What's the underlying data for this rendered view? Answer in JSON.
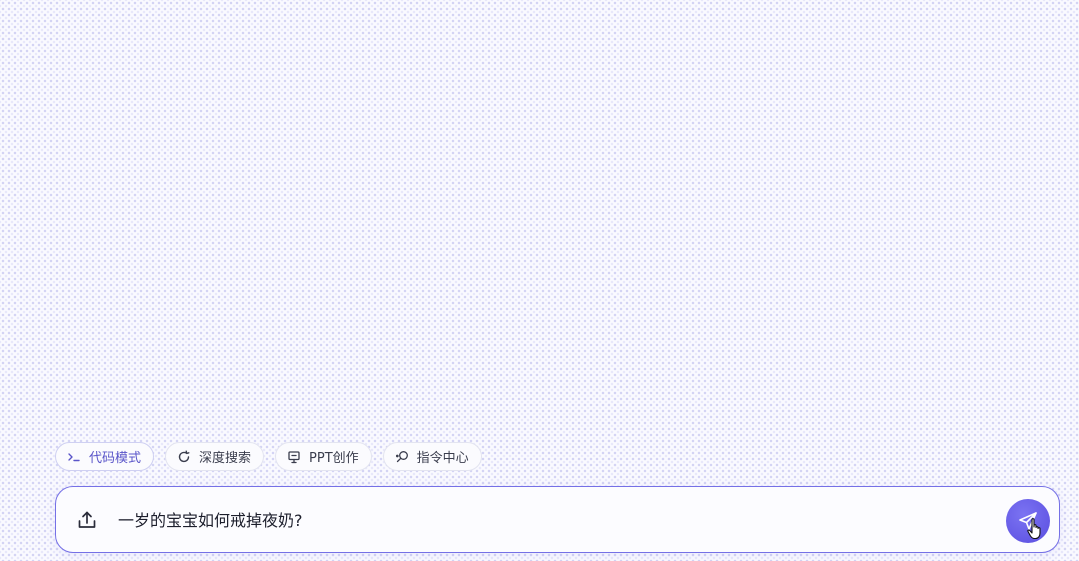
{
  "modes": [
    {
      "label": "代码模式",
      "icon": "terminal-icon",
      "active": true
    },
    {
      "label": "深度搜索",
      "icon": "refresh-search-icon",
      "active": false
    },
    {
      "label": "PPT创作",
      "icon": "presentation-icon",
      "active": false
    },
    {
      "label": "指令中心",
      "icon": "command-center-icon",
      "active": false
    }
  ],
  "input": {
    "value": "一岁的宝宝如何戒掉夜奶?",
    "upload_icon": "upload-icon",
    "send_icon": "send-icon"
  },
  "colors": {
    "accent": "#6f66ea",
    "active_chip_text": "#5a55c9",
    "background_dots": "#9b9be6"
  }
}
